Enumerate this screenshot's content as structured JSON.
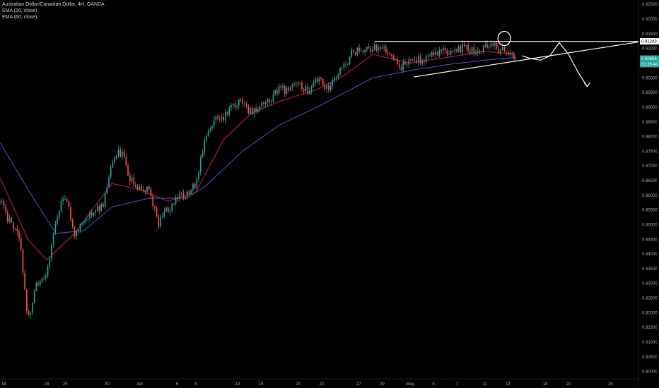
{
  "legend": {
    "title": "Australian Dollar/Canadian Dollar, 4H, OANDA",
    "ema20": "EMA (20, close)",
    "ema60": "EMA (60, close)"
  },
  "colors": {
    "background": "#000000",
    "up": "#26a69a",
    "down": "#ef5350",
    "ema20": "#c2185b",
    "ema60": "#5c4bc4",
    "drawing": "#ffffff",
    "axis_text": "#aaaaaa"
  },
  "price_tags": {
    "resistance": "0.91243",
    "last": "0.90656",
    "countdown": "01:26:44"
  },
  "chart_data": {
    "type": "candlestick",
    "title": "Australian Dollar/Canadian Dollar, 4H, OANDA",
    "ylim": [
      0.7975,
      0.9265
    ],
    "y_ticks": [
      "0.92500",
      "0.92000",
      "0.91500",
      "0.91000",
      "0.90500",
      "0.90000",
      "0.89500",
      "0.89000",
      "0.88500",
      "0.88000",
      "0.87500",
      "0.87000",
      "0.86500",
      "0.86000",
      "0.85500",
      "0.85000",
      "0.84500",
      "0.84000",
      "0.83500",
      "0.83000",
      "0.82500",
      "0.82000",
      "0.81500",
      "0.81000",
      "0.80500",
      "0.80000"
    ],
    "x_ticks": [
      "18",
      "23",
      "25",
      "30",
      "Apr",
      "6",
      "8",
      "13",
      "15",
      "20",
      "22",
      "27",
      "29",
      "May",
      "5",
      "7",
      "11",
      "13",
      "18",
      "20",
      "25"
    ],
    "x_tick_positions": [
      0.4,
      5.0,
      7.0,
      11.5,
      15.0,
      19.0,
      21.0,
      25.5,
      28.0,
      32.0,
      34.5,
      38.5,
      41.0,
      44.0,
      46.5,
      49.0,
      52.0,
      54.5,
      58.5,
      61.0,
      65.5
    ],
    "anchors": [
      [
        0,
        0.858
      ],
      [
        1,
        0.851
      ],
      [
        2,
        0.848
      ],
      [
        3,
        0.818
      ],
      [
        4,
        0.83
      ],
      [
        5,
        0.832
      ],
      [
        6,
        0.852
      ],
      [
        7,
        0.86
      ],
      [
        8,
        0.846
      ],
      [
        9,
        0.852
      ],
      [
        10,
        0.854
      ],
      [
        11,
        0.856
      ],
      [
        12,
        0.872
      ],
      [
        13,
        0.875
      ],
      [
        14,
        0.865
      ],
      [
        15,
        0.863
      ],
      [
        16,
        0.861
      ],
      [
        17,
        0.85
      ],
      [
        18,
        0.855
      ],
      [
        19,
        0.86
      ],
      [
        20,
        0.86
      ],
      [
        21,
        0.864
      ],
      [
        22,
        0.879
      ],
      [
        23,
        0.886
      ],
      [
        24,
        0.886
      ],
      [
        25,
        0.89
      ],
      [
        26,
        0.892
      ],
      [
        27,
        0.888
      ],
      [
        28,
        0.89
      ],
      [
        29,
        0.893
      ],
      [
        30,
        0.896
      ],
      [
        31,
        0.895
      ],
      [
        32,
        0.899
      ],
      [
        33,
        0.895
      ],
      [
        34,
        0.899
      ],
      [
        35,
        0.897
      ],
      [
        36,
        0.899
      ],
      [
        37,
        0.905
      ],
      [
        38,
        0.909
      ],
      [
        39,
        0.91
      ],
      [
        40,
        0.91
      ],
      [
        41,
        0.91
      ],
      [
        42,
        0.907
      ],
      [
        43,
        0.904
      ],
      [
        44,
        0.905
      ],
      [
        45,
        0.906
      ],
      [
        46,
        0.907
      ],
      [
        47,
        0.908
      ],
      [
        48,
        0.909
      ],
      [
        49,
        0.91
      ],
      [
        50,
        0.91
      ],
      [
        51,
        0.909
      ],
      [
        52,
        0.911
      ],
      [
        53,
        0.911
      ],
      [
        54,
        0.909
      ],
      [
        54.5,
        0.908
      ],
      [
        55.4,
        0.9066
      ]
    ],
    "ema20_points": [
      [
        0,
        0.866
      ],
      [
        3,
        0.845
      ],
      [
        5,
        0.838
      ],
      [
        8,
        0.847
      ],
      [
        12,
        0.864
      ],
      [
        15,
        0.862
      ],
      [
        18,
        0.858
      ],
      [
        21,
        0.861
      ],
      [
        24,
        0.879
      ],
      [
        27,
        0.888
      ],
      [
        30,
        0.892
      ],
      [
        34,
        0.896
      ],
      [
        37,
        0.901
      ],
      [
        40,
        0.908
      ],
      [
        44,
        0.905
      ],
      [
        48,
        0.907
      ],
      [
        52,
        0.909
      ],
      [
        55.4,
        0.908
      ]
    ],
    "ema60_points": [
      [
        0,
        0.878
      ],
      [
        3,
        0.862
      ],
      [
        6,
        0.847
      ],
      [
        9,
        0.848
      ],
      [
        12,
        0.856
      ],
      [
        16,
        0.859
      ],
      [
        20,
        0.859
      ],
      [
        22,
        0.863
      ],
      [
        26,
        0.875
      ],
      [
        30,
        0.884
      ],
      [
        34,
        0.89
      ],
      [
        37,
        0.895
      ],
      [
        40,
        0.9
      ],
      [
        44,
        0.9025
      ],
      [
        48,
        0.9045
      ],
      [
        52,
        0.906
      ],
      [
        55.4,
        0.907
      ]
    ],
    "drawings": {
      "resistance_line": {
        "x": [
          40.2,
          68.5
        ],
        "y": 0.9124
      },
      "rising_trendline": {
        "x": [
          44.4,
          68.5
        ],
        "y": [
          0.9003,
          0.9122
        ]
      },
      "circled_high": {
        "x": 54.1,
        "y": 0.9134
      },
      "projected_path": [
        [
          56.0,
          0.9075
        ],
        [
          57.0,
          0.9065
        ],
        [
          58.0,
          0.906
        ],
        [
          59.0,
          0.9075
        ],
        [
          60.0,
          0.912
        ],
        [
          61.0,
          0.908
        ],
        [
          62.0,
          0.902
        ],
        [
          63.0,
          0.897
        ]
      ]
    }
  }
}
